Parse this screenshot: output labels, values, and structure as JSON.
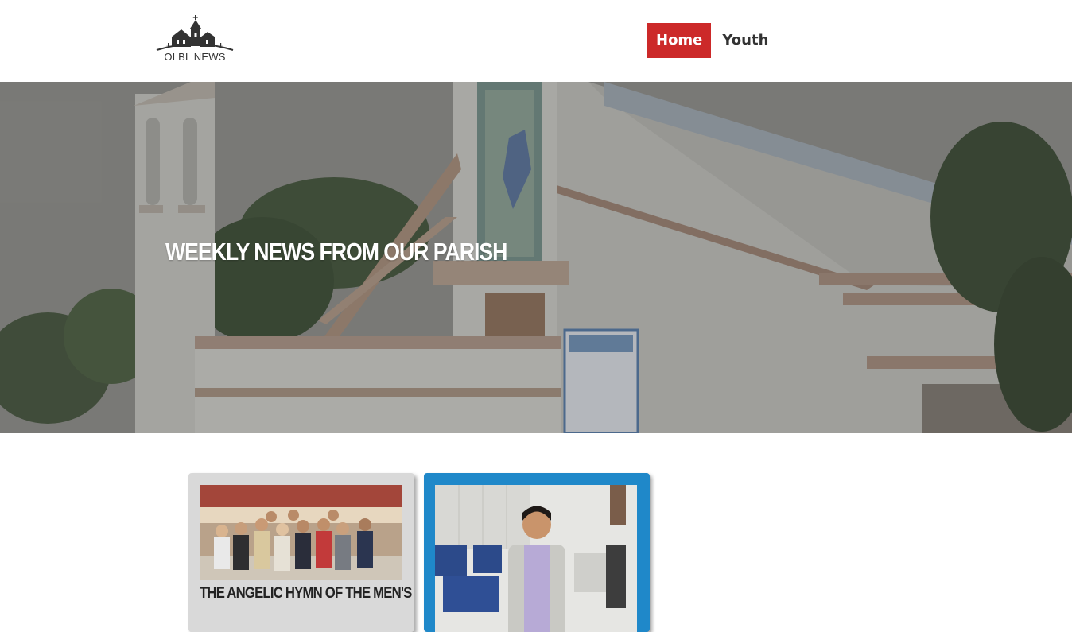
{
  "header": {
    "logo_text": "OLBL NEWS",
    "logo_icon": "church-icon",
    "nav": [
      {
        "label": "Home",
        "active": true
      },
      {
        "label": "Youth",
        "active": false
      }
    ],
    "accent_color": "#cc2929"
  },
  "hero": {
    "title": "WEEKLY NEWS FROM OUR PARISH"
  },
  "cards": [
    {
      "title": "THE ANGELIC HYMN OF THE MEN'S",
      "background": "#d9d9d9"
    },
    {
      "title": "",
      "background": "#1f88c9"
    }
  ]
}
